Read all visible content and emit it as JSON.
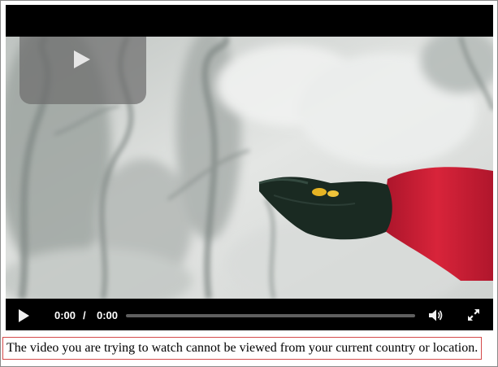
{
  "player": {
    "controls": {
      "current_time": "0:00",
      "separator": "/",
      "duration": "0:00",
      "progress_fraction": 0,
      "play_icon": "play-icon",
      "volume_icon": "volume-icon",
      "fullscreen_icon": "fullscreen-icon"
    },
    "big_play_icon": "play-icon"
  },
  "notice": {
    "message": "The video you are trying to watch cannot be viewed from your current country or location."
  },
  "colors": {
    "notice_border": "#d44a4a",
    "player_background": "#000000",
    "glove_sleeve": "#c41a2e",
    "glove": "#1a2a22"
  }
}
